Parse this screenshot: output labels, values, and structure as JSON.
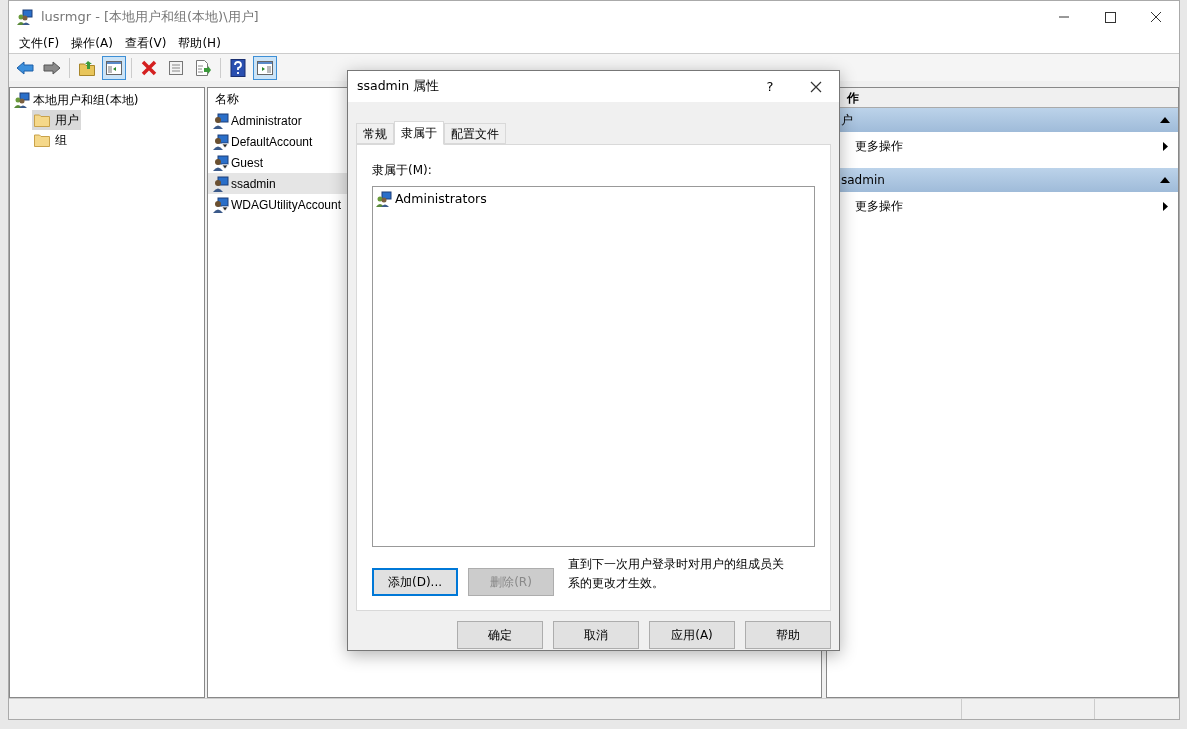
{
  "window": {
    "title": "lusrmgr - [本地用户和组(本地)\\用户]"
  },
  "menu": [
    "文件(F)",
    "操作(A)",
    "查看(V)",
    "帮助(H)"
  ],
  "toolbar": [
    {
      "kind": "back",
      "on": false
    },
    {
      "kind": "forward",
      "on": false
    },
    {
      "kind": "sep"
    },
    {
      "kind": "up",
      "on": false
    },
    {
      "kind": "tree",
      "on": true
    },
    {
      "kind": "sep"
    },
    {
      "kind": "delete",
      "on": false
    },
    {
      "kind": "properties",
      "on": false
    },
    {
      "kind": "export",
      "on": false
    },
    {
      "kind": "sep"
    },
    {
      "kind": "help",
      "on": false
    },
    {
      "kind": "actionpane",
      "on": true
    }
  ],
  "tree": {
    "label": "本地用户和组(本地)",
    "children": [
      {
        "label": "用户",
        "selected": true
      },
      {
        "label": "组",
        "selected": false
      }
    ]
  },
  "list": {
    "columns": [
      "名称"
    ],
    "rows": [
      {
        "name": "Administrator",
        "kind": "user",
        "selected": false
      },
      {
        "name": "DefaultAccount",
        "kind": "disabled-user",
        "selected": false
      },
      {
        "name": "Guest",
        "kind": "disabled-user",
        "selected": false
      },
      {
        "name": "ssadmin",
        "kind": "user",
        "selected": true
      },
      {
        "name": "WDAGUtilityAccount",
        "kind": "disabled-user",
        "selected": false
      }
    ]
  },
  "actions": {
    "title": "作",
    "sections": [
      {
        "title": "户",
        "expanded": true,
        "items": [
          "更多操作"
        ]
      },
      {
        "title": "sadmin",
        "expanded": true,
        "items": [
          "更多操作"
        ]
      }
    ]
  },
  "dialog": {
    "title": "ssadmin 属性",
    "help": "?",
    "tabs": [
      {
        "label": "常规",
        "selected": false
      },
      {
        "label": "隶属于",
        "selected": true
      },
      {
        "label": "配置文件",
        "selected": false
      }
    ],
    "member_label": "隶属于(M):",
    "members": [
      "Administrators"
    ],
    "buttons": [
      {
        "label": "添加(D)...",
        "disabled": false,
        "focused": true
      },
      {
        "label": "删除(R)",
        "disabled": true,
        "focused": false
      }
    ],
    "note": "直到下一次用户登录时对用户的组成员关系的更改才生效。",
    "footer": [
      "确定",
      "取消",
      "应用(A)",
      "帮助"
    ]
  }
}
